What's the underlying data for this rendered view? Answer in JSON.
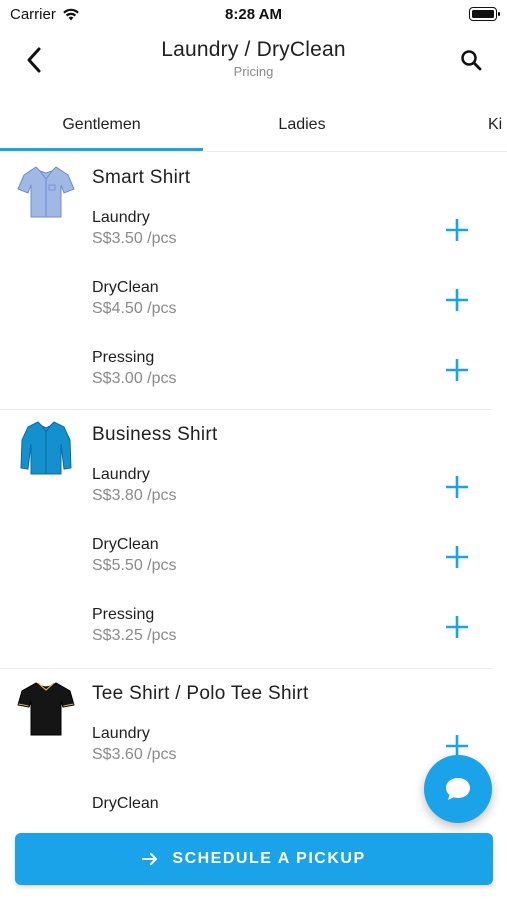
{
  "status_bar": {
    "carrier": "Carrier",
    "time": "8:28 AM"
  },
  "header": {
    "title": "Laundry / DryClean",
    "subtitle": "Pricing",
    "back_icon": "chevron-left-icon",
    "search_icon": "search-icon"
  },
  "tabs": [
    {
      "label": "Gentlemen",
      "selected": true
    },
    {
      "label": "Ladies",
      "selected": false
    },
    {
      "label": "Ki",
      "selected": false
    }
  ],
  "products": [
    {
      "name": "Smart Shirt",
      "image_icon": "light-blue-shirt-icon",
      "services": [
        {
          "name": "Laundry",
          "price": "S$3.50 /pcs"
        },
        {
          "name": "DryClean",
          "price": "S$4.50 /pcs"
        },
        {
          "name": "Pressing",
          "price": "S$3.00 /pcs"
        }
      ]
    },
    {
      "name": "Business Shirt",
      "image_icon": "blue-long-sleeve-shirt-icon",
      "services": [
        {
          "name": "Laundry",
          "price": "S$3.80 /pcs"
        },
        {
          "name": "DryClean",
          "price": "S$5.50 /pcs"
        },
        {
          "name": "Pressing",
          "price": "S$3.25 /pcs"
        }
      ]
    },
    {
      "name": "Tee Shirt / Polo Tee Shirt",
      "image_icon": "black-polo-shirt-icon",
      "services": [
        {
          "name": "Laundry",
          "price": "S$3.60 /pcs"
        },
        {
          "name": "DryClean",
          "price": ""
        }
      ]
    }
  ],
  "fab": {
    "icon": "chat-bubble-icon"
  },
  "cta": {
    "label": "SCHEDULE A PICKUP",
    "icon": "arrow-right-icon"
  },
  "colors": {
    "accent": "#1aa3e8",
    "text": "#1f1f1f",
    "muted": "#8a8a8a"
  }
}
